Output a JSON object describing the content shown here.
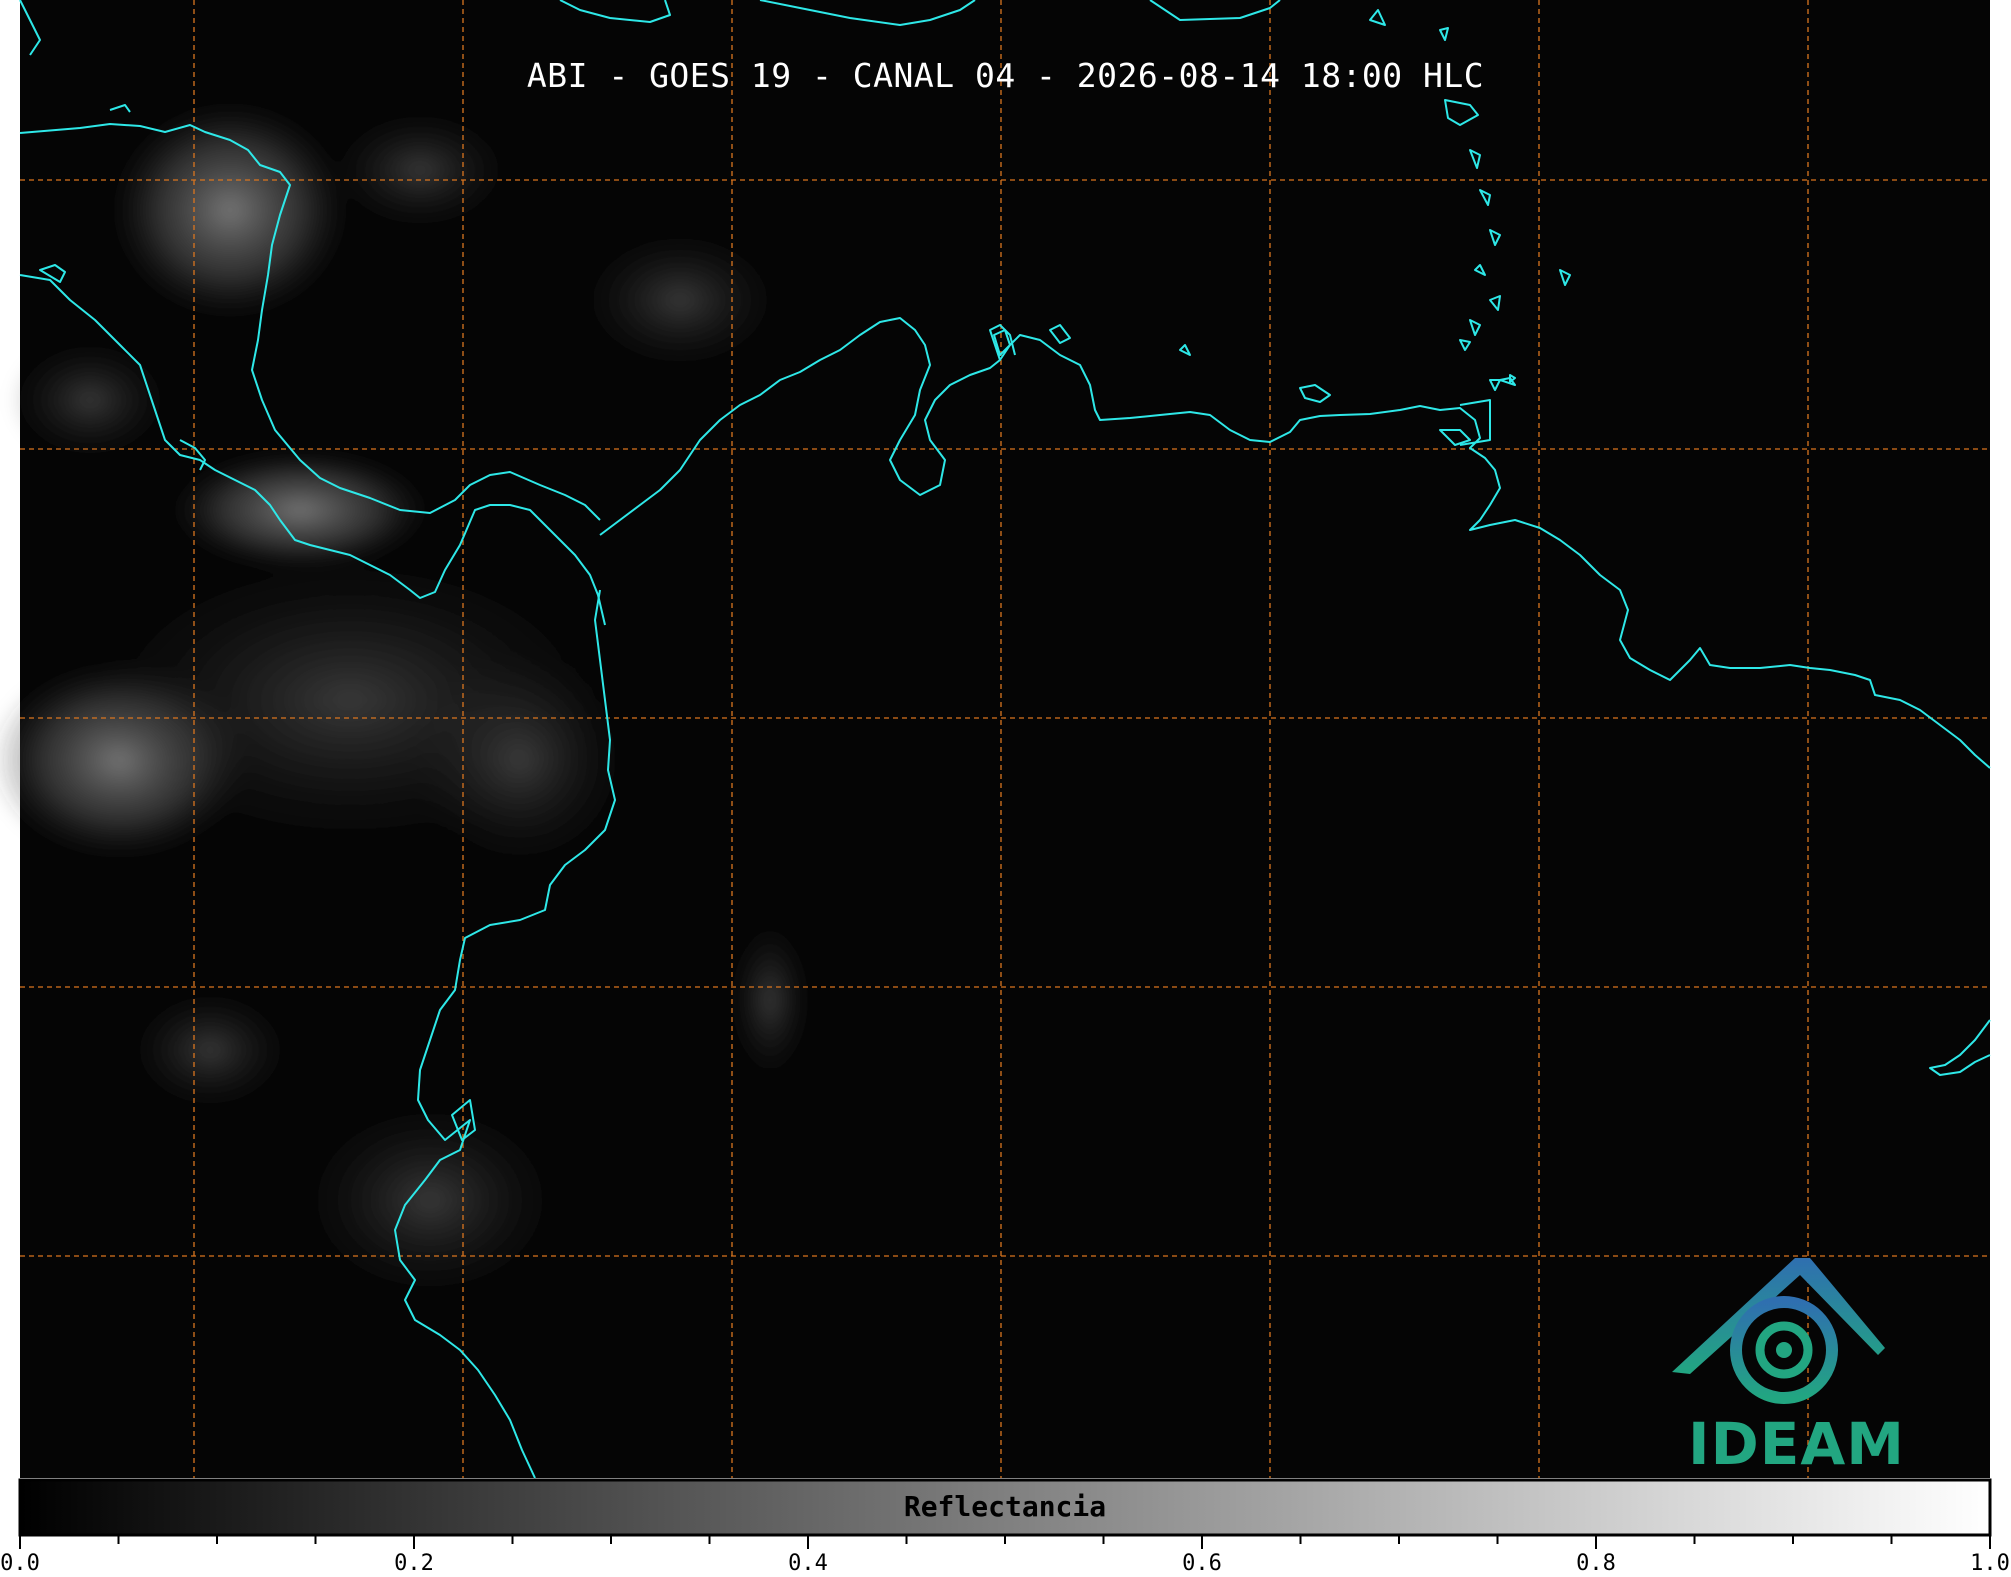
{
  "title": "ABI - GOES 19 - CANAL 04 - 2026-08-14 18:00 HLC",
  "colorbar": {
    "label": "Reflectancia",
    "min": 0.0,
    "max": 1.0,
    "tick_labels": [
      "0.0",
      "0.2",
      "0.4",
      "0.6",
      "0.8",
      "1.0"
    ]
  },
  "logo": {
    "text": "IDEAM"
  },
  "colors": {
    "background": "#050505",
    "coastline": "#2ee8e8",
    "gridline": "#d9751f",
    "logo_green": "#22a681",
    "logo_blue": "#2f6fb0"
  }
}
